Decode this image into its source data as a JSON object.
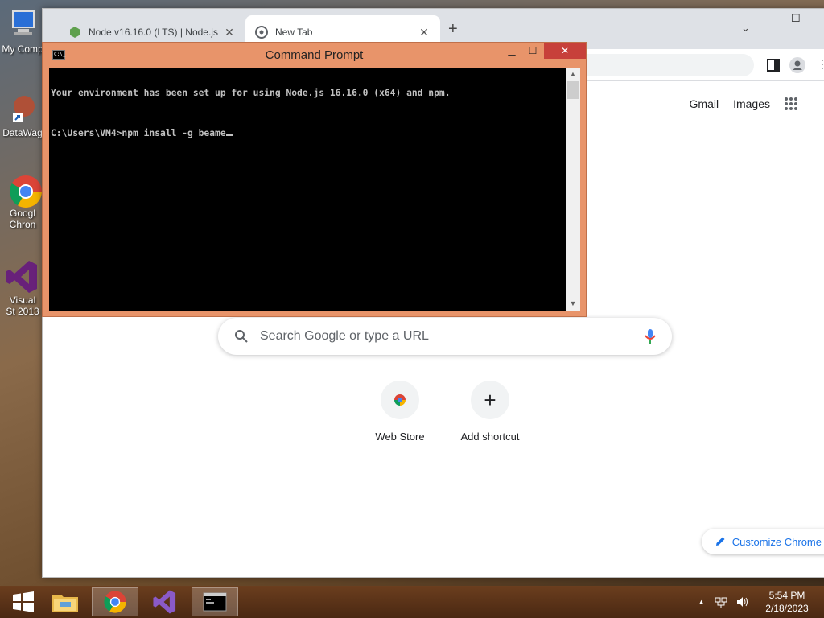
{
  "desktop": {
    "icons": [
      {
        "label": "My Comp",
        "name": "my-computer"
      },
      {
        "label": "DataWag",
        "name": "datawag"
      },
      {
        "label": "Googl Chron",
        "name": "google-chrome"
      },
      {
        "label": "Visual St 2013",
        "name": "visual-studio"
      }
    ]
  },
  "chrome": {
    "tabs": [
      {
        "title": "Node v16.16.0 (LTS) | Node.js",
        "close": "✕"
      },
      {
        "title": "New Tab",
        "close": "✕"
      }
    ],
    "new_tab": "+",
    "top_links": {
      "gmail": "Gmail",
      "images": "Images"
    },
    "search": {
      "placeholder": "Search Google or type a URL"
    },
    "shortcuts": [
      {
        "label": "Web Store"
      },
      {
        "label": "Add shortcut",
        "glyph": "+"
      }
    ],
    "customize": "Customize Chrome"
  },
  "cmd": {
    "title": "Command Prompt",
    "icon_text": "C:\\_",
    "lines": [
      "Your environment has been set up for using Node.js 16.16.0 (x64) and npm.",
      "C:\\Users\\VM4>npm insall -g beame"
    ],
    "buttons": {
      "minimize": "▁",
      "maximize": "☐",
      "close": "✕"
    }
  },
  "taskbar": {
    "time": "5:54 PM",
    "date": "2/18/2023"
  },
  "colors": {
    "cmd_frame": "#e8946a",
    "close_red": "#c7403a",
    "link_blue": "#1a73e8"
  }
}
